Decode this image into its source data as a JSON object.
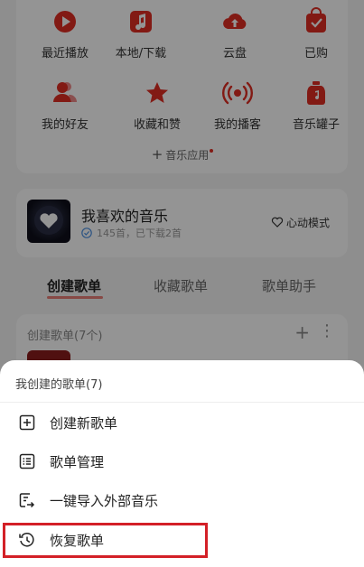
{
  "grid": {
    "row1": [
      {
        "label": "最近播放",
        "icon": "play-circle-icon"
      },
      {
        "label": "本地/下载",
        "icon": "music-note-icon"
      },
      {
        "label": "云盘",
        "icon": "cloud-upload-icon"
      },
      {
        "label": "已购",
        "icon": "purchased-bag-icon"
      }
    ],
    "row2": [
      {
        "label": "我的好友",
        "icon": "friends-icon"
      },
      {
        "label": "收藏和赞",
        "icon": "star-icon"
      },
      {
        "label": "我的播客",
        "icon": "broadcast-icon"
      },
      {
        "label": "音乐罐子",
        "icon": "music-jar-icon"
      }
    ],
    "music_apps": "音乐应用"
  },
  "favorite": {
    "title": "我喜欢的音乐",
    "subtitle": "145首，已下载2首",
    "heart_mode": "心动模式"
  },
  "tabs": [
    "创建歌单",
    "收藏歌单",
    "歌单助手"
  ],
  "list": {
    "title": "创建歌单(7个)"
  },
  "sheet": {
    "title": "我创建的歌单(7)",
    "items": [
      {
        "label": "创建新歌单",
        "icon": "add-square-icon"
      },
      {
        "label": "歌单管理",
        "icon": "list-manage-icon"
      },
      {
        "label": "一键导入外部音乐",
        "icon": "import-icon"
      },
      {
        "label": "恢复歌单",
        "icon": "history-restore-icon"
      }
    ]
  },
  "colors": {
    "accent": "#e02e24",
    "highlight": "#d32027"
  }
}
